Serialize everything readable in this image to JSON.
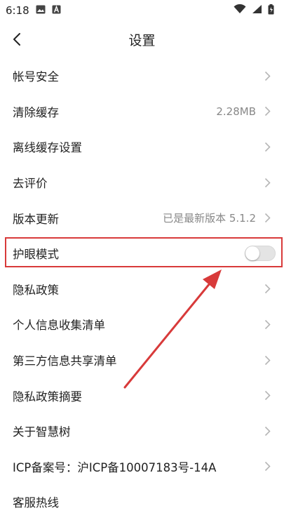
{
  "status_bar": {
    "time": "6:18",
    "icons_left": [
      "image-icon",
      "a-icon"
    ],
    "icons_right": [
      "wifi-icon",
      "signal-icon",
      "battery-icon"
    ]
  },
  "header": {
    "title": "设置",
    "back_icon": "chevron-left-icon"
  },
  "settings": {
    "items": [
      {
        "label": "帐号安全",
        "value": ""
      },
      {
        "label": "清除缓存",
        "value": "2.28MB"
      },
      {
        "label": "离线缓存设置",
        "value": ""
      },
      {
        "label": "去评价",
        "value": ""
      },
      {
        "label": "版本更新",
        "value": "已是最新版本 5.1.2"
      },
      {
        "label": "护眼模式",
        "toggle": "off"
      },
      {
        "label": "隐私政策",
        "value": ""
      },
      {
        "label": "个人信息收集清单",
        "value": ""
      },
      {
        "label": "第三方信息共享清单",
        "value": ""
      },
      {
        "label": "隐私政策摘要",
        "value": ""
      },
      {
        "label": "关于智慧树",
        "value": ""
      },
      {
        "label": "ICP备案号：沪ICP备10007183号-14A",
        "value": ""
      },
      {
        "label": "客服热线",
        "value": ""
      }
    ]
  },
  "colors": {
    "annotation_red": "#d83a3a",
    "chevron_gray": "#b5b5b5",
    "value_gray": "#888888"
  }
}
